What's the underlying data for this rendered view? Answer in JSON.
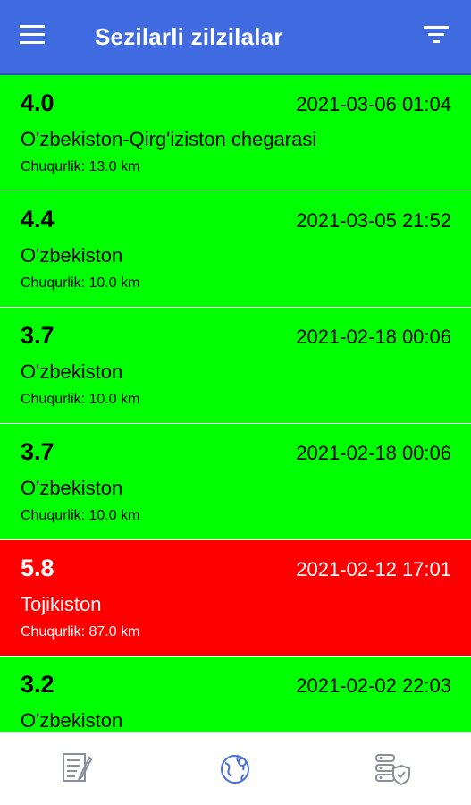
{
  "app": {
    "title": "Sezilarli zilzilalar",
    "colors": {
      "appbar": "#3f6ae0",
      "felt_low": "#00ff00",
      "felt_high": "#ff0000"
    }
  },
  "toolbar": {
    "menu_icon": "hamburger-menu-icon",
    "filter_icon": "filter-icon"
  },
  "earthquakes": [
    {
      "magnitude": "4.0",
      "datetime": "2021-03-06 01:04",
      "location": "O'zbekiston-Qirg'iziston chegarasi",
      "depth": "Chuqurlik: 13.0 km",
      "color": "#00ff00"
    },
    {
      "magnitude": "4.4",
      "datetime": "2021-03-05 21:52",
      "location": "O'zbekiston",
      "depth": "Chuqurlik: 10.0 km",
      "color": "#00ff00"
    },
    {
      "magnitude": "3.7",
      "datetime": "2021-02-18 00:06",
      "location": "O'zbekiston",
      "depth": "Chuqurlik: 10.0 km",
      "color": "#00ff00"
    },
    {
      "magnitude": "3.7",
      "datetime": "2021-02-18 00:06",
      "location": "O'zbekiston",
      "depth": "Chuqurlik: 10.0 km",
      "color": "#00ff00"
    },
    {
      "magnitude": "5.8",
      "datetime": "2021-02-12 17:01",
      "location": "Tojikiston",
      "depth": "Chuqurlik: 87.0 km",
      "color": "#ff0000"
    },
    {
      "magnitude": "3.2",
      "datetime": "2021-02-02 22:03",
      "location": "O'zbekiston",
      "depth": "",
      "color": "#00ff00"
    }
  ],
  "bottom_nav": [
    {
      "icon": "news-document-icon"
    },
    {
      "icon": "globe-map-icon"
    },
    {
      "icon": "settings-shield-icon"
    }
  ]
}
